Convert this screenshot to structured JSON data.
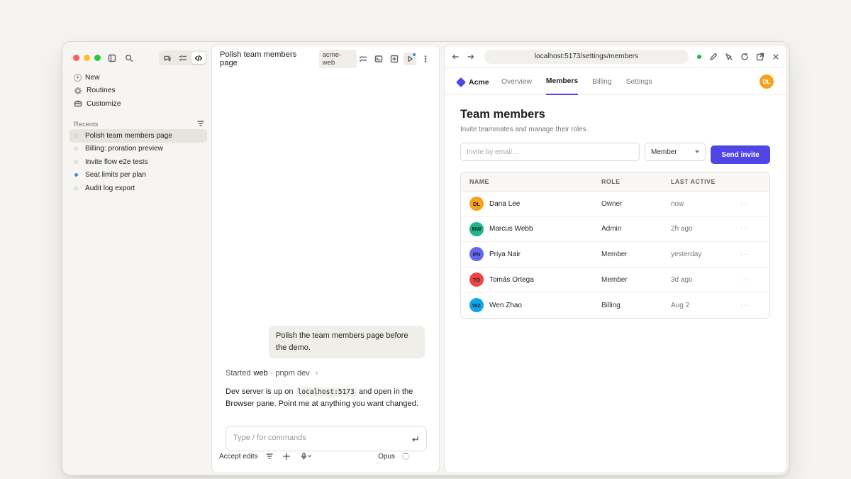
{
  "sidebar": {
    "nav": [
      {
        "label": "New",
        "icon": "plus-icon"
      },
      {
        "label": "Routines",
        "icon": "routines-icon"
      },
      {
        "label": "Customize",
        "icon": "briefcase-icon"
      }
    ],
    "recents_label": "Recents",
    "recents": [
      {
        "label": "Polish team members page",
        "active": true,
        "status": "idle"
      },
      {
        "label": "Billing: proration preview",
        "active": false,
        "status": "idle"
      },
      {
        "label": "Invite flow e2e tests",
        "active": false,
        "status": "idle"
      },
      {
        "label": "Seat limits per plan",
        "active": false,
        "status": "running"
      },
      {
        "label": "Audit log export",
        "active": false,
        "status": "idle"
      }
    ]
  },
  "chat": {
    "title": "Polish team members page",
    "repo": "acme-web",
    "user_message": "Polish the team members page before the demo.",
    "started_prefix": "Started",
    "started_name": "web",
    "started_cmd": "· pnpm dev",
    "reply_before": "Dev server is up on ",
    "reply_code": "localhost:5173",
    "reply_after": " and open in the Browser pane. Point me at anything you want changed.",
    "composer_placeholder": "Type / for commands",
    "accept_label": "Accept edits",
    "model": "Opus"
  },
  "browser": {
    "url": "localhost:5173/settings/members",
    "status_color": "#2bb24c"
  },
  "app": {
    "brand": "Acme",
    "brand_color": "#5046e5",
    "tabs": [
      "Overview",
      "Members",
      "Billing",
      "Settings"
    ],
    "active_tab": "Members",
    "user_initials": "DL",
    "page_title": "Team members",
    "page_subtitle": "Invite teammates and manage their roles.",
    "invite_placeholder": "Invite by email…",
    "role_value": "Member",
    "send_label": "Send invite",
    "columns": [
      "NAME",
      "ROLE",
      "LAST ACTIVE"
    ],
    "members": [
      {
        "initials": "DL",
        "name": "Dana Lee",
        "role": "Owner",
        "last": "now",
        "color": "#f4a41c"
      },
      {
        "initials": "MW",
        "name": "Marcus Webb",
        "role": "Admin",
        "last": "2h ago",
        "color": "#1fb58a"
      },
      {
        "initials": "PN",
        "name": "Priya Nair",
        "role": "Member",
        "last": "yesterday",
        "color": "#6366f1"
      },
      {
        "initials": "TO",
        "name": "Tomás Ortega",
        "role": "Member",
        "last": "3d ago",
        "color": "#ef4444"
      },
      {
        "initials": "WZ",
        "name": "Wen Zhao",
        "role": "Billing",
        "last": "Aug 2",
        "color": "#0ea5e9"
      }
    ]
  }
}
